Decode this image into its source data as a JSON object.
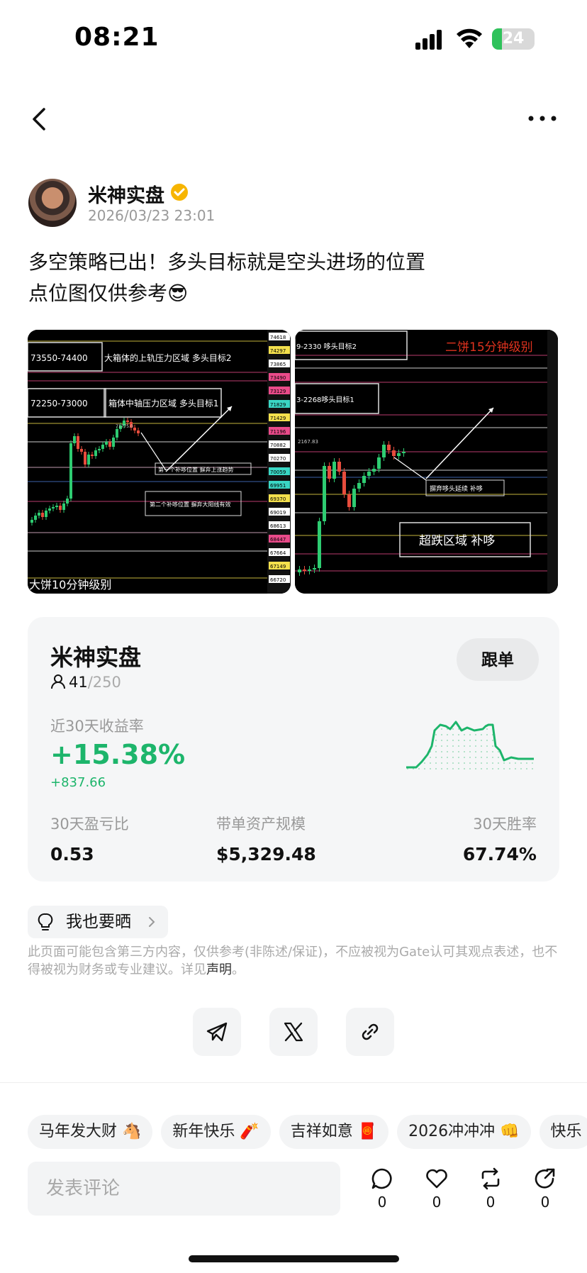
{
  "status_bar": {
    "time": "08:21",
    "battery": "24",
    "battery_level": 0.24
  },
  "post": {
    "author": "米神实盘",
    "timestamp": "2026/03/23 23:01",
    "text_line1": "多空策略已出！多头目标就是空头进场的位置",
    "text_line2": "点位图仅供参考😎"
  },
  "chart_left": {
    "title": "大饼10分钟级别",
    "range1": "73550-74400",
    "range1_note": "大箱体的上轨压力区域 多头目标2",
    "range2": "72250-73000",
    "range2_note": "箱体中轴压力区域 多头目标1",
    "note3": "第一个补哆位置 摒弃上涨趋势",
    "note4": "第二个补哆位置 摒弃大阳线有效",
    "peak_label": "71775.0",
    "axis_labels": [
      "74618",
      "74297",
      "73865",
      "73490",
      "73129",
      "71829",
      "71429",
      "71196",
      "70882",
      "70270",
      "70059",
      "69951",
      "69370",
      "69019",
      "68613",
      "68447",
      "67664",
      "67149",
      "66720"
    ]
  },
  "chart_right": {
    "title": "二饼15分钟级别",
    "range1": "9-2330 哆头目标2",
    "range2": "3-2268哆头目标1",
    "note3": "摒弃哆头延续 补哆",
    "note4": "超跌区域 补哆",
    "peak_label": "2167.83"
  },
  "trader": {
    "name": "米神实盘",
    "follow_label": "跟单",
    "followers": "41",
    "followers_cap": "/250",
    "roi_label": "近30天收益率",
    "roi_value": "+15.38%",
    "roi_amount": "+837.66",
    "stats": [
      {
        "label": "30天盈亏比",
        "value": "0.53"
      },
      {
        "label": "带单资产规模",
        "value": "$5,329.48"
      },
      {
        "label": "30天胜率",
        "value": "67.74%"
      }
    ],
    "accent_color": "#1db56b"
  },
  "share_chip": {
    "label": "我也要晒"
  },
  "disclaimer": {
    "text": "此页面可能包含第三方内容，仅供参考(非陈述/保证)，不应被视为Gate认可其观点表述，也不得被视为财务或专业建议。详见",
    "link": "声明",
    "end": "。"
  },
  "tags": [
    "马年发大财 🐴",
    "新年快乐 🧨",
    "吉祥如意 🧧",
    "2026冲冲冲 👊",
    "快乐"
  ],
  "comment": {
    "placeholder": "发表评论"
  },
  "actions": {
    "comments": "0",
    "likes": "0",
    "reposts": "0",
    "shares": "0"
  }
}
